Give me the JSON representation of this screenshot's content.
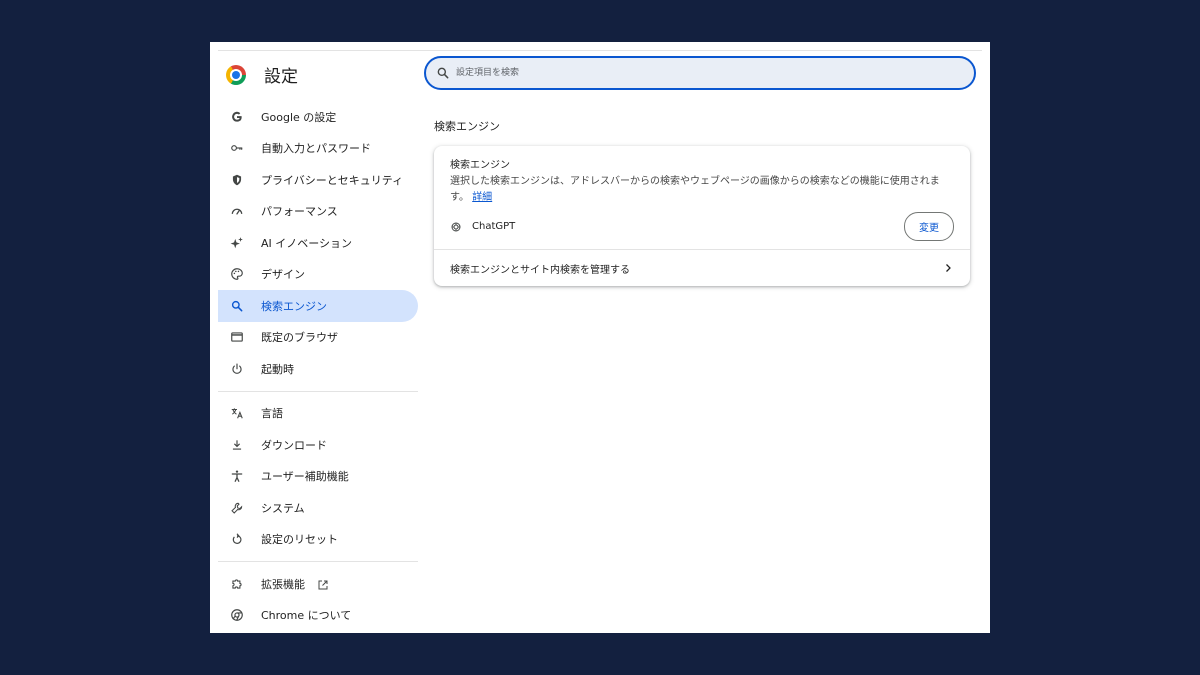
{
  "header": {
    "title": "設定"
  },
  "search": {
    "placeholder": "設定項目を検索",
    "value": ""
  },
  "sidebar": {
    "items": [
      {
        "label": "Google の設定",
        "icon": "google-icon"
      },
      {
        "label": "自動入力とパスワード",
        "icon": "key-icon"
      },
      {
        "label": "プライバシーとセキュリティ",
        "icon": "shield-icon"
      },
      {
        "label": "パフォーマンス",
        "icon": "speedometer-icon"
      },
      {
        "label": "AI イノベーション",
        "icon": "sparkle-icon"
      },
      {
        "label": "デザイン",
        "icon": "palette-icon"
      },
      {
        "label": "検索エンジン",
        "icon": "search-icon",
        "active": true
      },
      {
        "label": "既定のブラウザ",
        "icon": "browser-window-icon"
      },
      {
        "label": "起動時",
        "icon": "power-icon"
      }
    ],
    "items2": [
      {
        "label": "言語",
        "icon": "translate-icon"
      },
      {
        "label": "ダウンロード",
        "icon": "download-icon"
      },
      {
        "label": "ユーザー補助機能",
        "icon": "accessibility-icon"
      },
      {
        "label": "システム",
        "icon": "wrench-icon"
      },
      {
        "label": "設定のリセット",
        "icon": "reset-icon"
      }
    ],
    "items3": [
      {
        "label": "拡張機能",
        "icon": "puzzle-icon"
      },
      {
        "label": "Chrome について",
        "icon": "chrome-icon"
      }
    ]
  },
  "main": {
    "section_title": "検索エンジン",
    "card": {
      "heading": "検索エンジン",
      "description": "選択した検索エンジンは、アドレスバーからの検索やウェブページの画像からの検索などの機能に使用されます。",
      "learn_more": "詳細",
      "engine_name": "ChatGPT",
      "change_label": "変更",
      "manage_label": "検索エンジンとサイト内検索を管理する"
    }
  },
  "colors": {
    "accent": "#0b57d0",
    "active_bg": "#d3e3fd",
    "backdrop": "#13203f"
  }
}
